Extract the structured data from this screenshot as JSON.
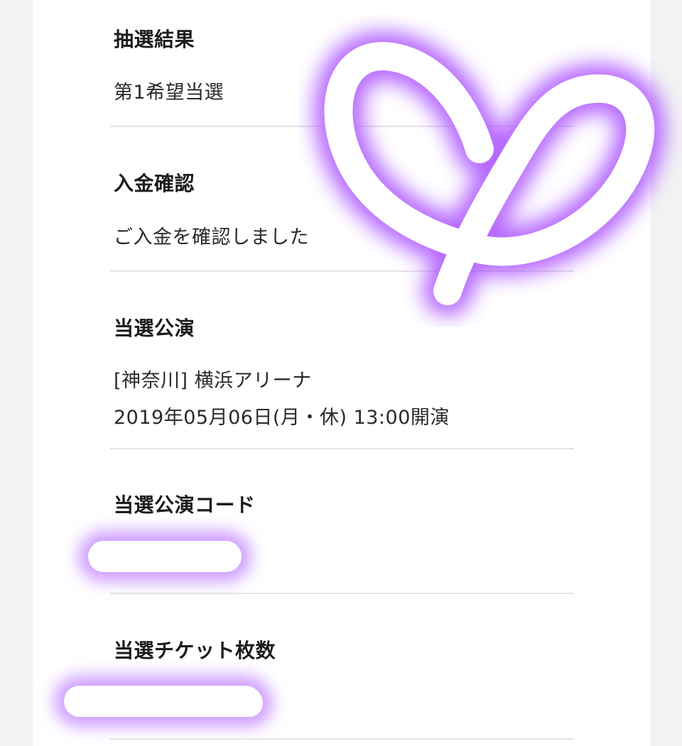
{
  "sections": [
    {
      "label": "抽選結果",
      "lines": [
        "第1希望当選"
      ]
    },
    {
      "label": "入金確認",
      "lines": [
        "ご入金を確認しました"
      ]
    },
    {
      "label": "当選公演",
      "lines": [
        "[神奈川] 横浜アリーナ",
        "2019年05月06日(月・休) 13:00開演"
      ]
    },
    {
      "label": "当選公演コード",
      "lines": []
    },
    {
      "label": "当選チケット枚数",
      "lines": []
    }
  ],
  "colors": {
    "glow": "#aa50ff",
    "stroke": "#ffffff",
    "divider": "#e3e3e6"
  },
  "decorations": {
    "overlay": "heart-doodle",
    "redaction": "white-marker-with-purple-glow"
  }
}
